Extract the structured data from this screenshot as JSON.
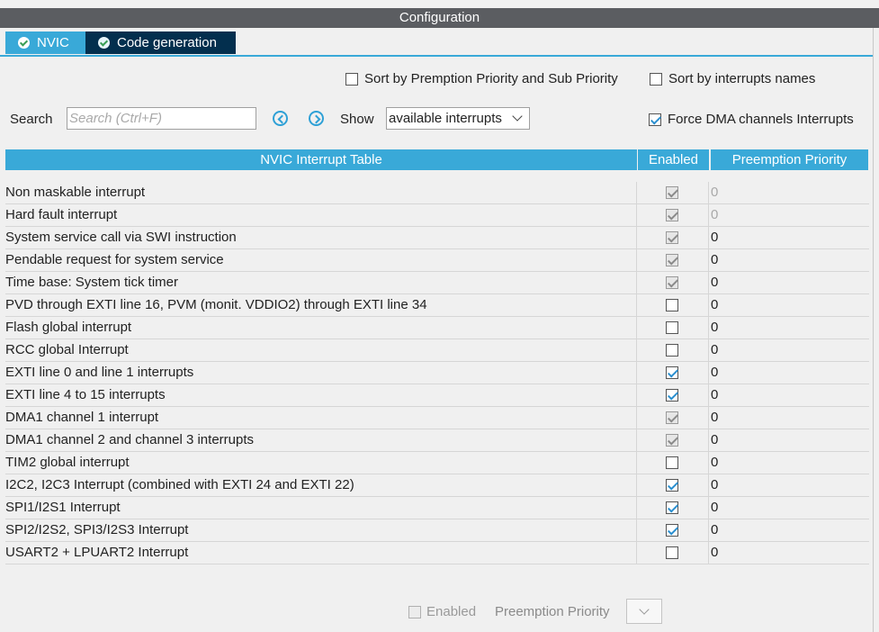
{
  "window": {
    "title": "Configuration"
  },
  "tabs": [
    {
      "label": "NVIC"
    },
    {
      "label": "Code generation"
    }
  ],
  "options": {
    "sort_priority": {
      "label": "Sort by Premption Priority and Sub Priority",
      "checked": false
    },
    "sort_names": {
      "label": "Sort by interrupts names",
      "checked": false
    },
    "force_dma": {
      "label": "Force DMA channels Interrupts",
      "checked": true
    }
  },
  "search": {
    "label": "Search",
    "placeholder": "Search (Ctrl+F)",
    "value": ""
  },
  "show": {
    "label": "Show",
    "value": "available interrupts"
  },
  "table": {
    "headers": [
      "NVIC Interrupt Table",
      "Enabled",
      "Preemption Priority"
    ],
    "rows": [
      {
        "name": "Non maskable interrupt",
        "enabled": true,
        "locked": true,
        "priority": "0",
        "priority_dim": true
      },
      {
        "name": "Hard fault interrupt",
        "enabled": true,
        "locked": true,
        "priority": "0",
        "priority_dim": true
      },
      {
        "name": "System service call via SWI instruction",
        "enabled": true,
        "locked": true,
        "priority": "0",
        "priority_dim": false
      },
      {
        "name": "Pendable request for system service",
        "enabled": true,
        "locked": true,
        "priority": "0",
        "priority_dim": false
      },
      {
        "name": "Time base: System tick timer",
        "enabled": true,
        "locked": true,
        "priority": "0",
        "priority_dim": false
      },
      {
        "name": "PVD through EXTI line 16, PVM (monit. VDDIO2) through EXTI line 34",
        "enabled": false,
        "locked": false,
        "priority": "0",
        "priority_dim": false
      },
      {
        "name": "Flash global interrupt",
        "enabled": false,
        "locked": false,
        "priority": "0",
        "priority_dim": false
      },
      {
        "name": "RCC global Interrupt",
        "enabled": false,
        "locked": false,
        "priority": "0",
        "priority_dim": false
      },
      {
        "name": "EXTI line 0 and line 1 interrupts",
        "enabled": true,
        "locked": false,
        "priority": "0",
        "priority_dim": false
      },
      {
        "name": "EXTI line 4 to 15 interrupts",
        "enabled": true,
        "locked": false,
        "priority": "0",
        "priority_dim": false
      },
      {
        "name": "DMA1 channel 1 interrupt",
        "enabled": true,
        "locked": true,
        "priority": "0",
        "priority_dim": false
      },
      {
        "name": "DMA1 channel 2 and channel 3 interrupts",
        "enabled": true,
        "locked": true,
        "priority": "0",
        "priority_dim": false
      },
      {
        "name": "TIM2 global interrupt",
        "enabled": false,
        "locked": false,
        "priority": "0",
        "priority_dim": false
      },
      {
        "name": "I2C2, I2C3 Interrupt (combined with EXTI 24 and EXTI 22)",
        "enabled": true,
        "locked": false,
        "priority": "0",
        "priority_dim": false
      },
      {
        "name": "SPI1/I2S1 Interrupt",
        "enabled": true,
        "locked": false,
        "priority": "0",
        "priority_dim": false
      },
      {
        "name": "SPI2/I2S2, SPI3/I2S3 Interrupt",
        "enabled": true,
        "locked": false,
        "priority": "0",
        "priority_dim": false
      },
      {
        "name": "USART2 + LPUART2 Interrupt",
        "enabled": false,
        "locked": false,
        "priority": "0",
        "priority_dim": false
      }
    ]
  },
  "footer": {
    "enabled_label": "Enabled",
    "priority_label": "Preemption Priority"
  },
  "colors": {
    "accent": "#39a9d8",
    "tab_dark": "#032f4e",
    "titlebar": "#5b5d61"
  },
  "icons": {
    "tab_status": "check-circle-icon",
    "prev": "chevron-left-circle-icon",
    "next": "chevron-right-circle-icon"
  }
}
